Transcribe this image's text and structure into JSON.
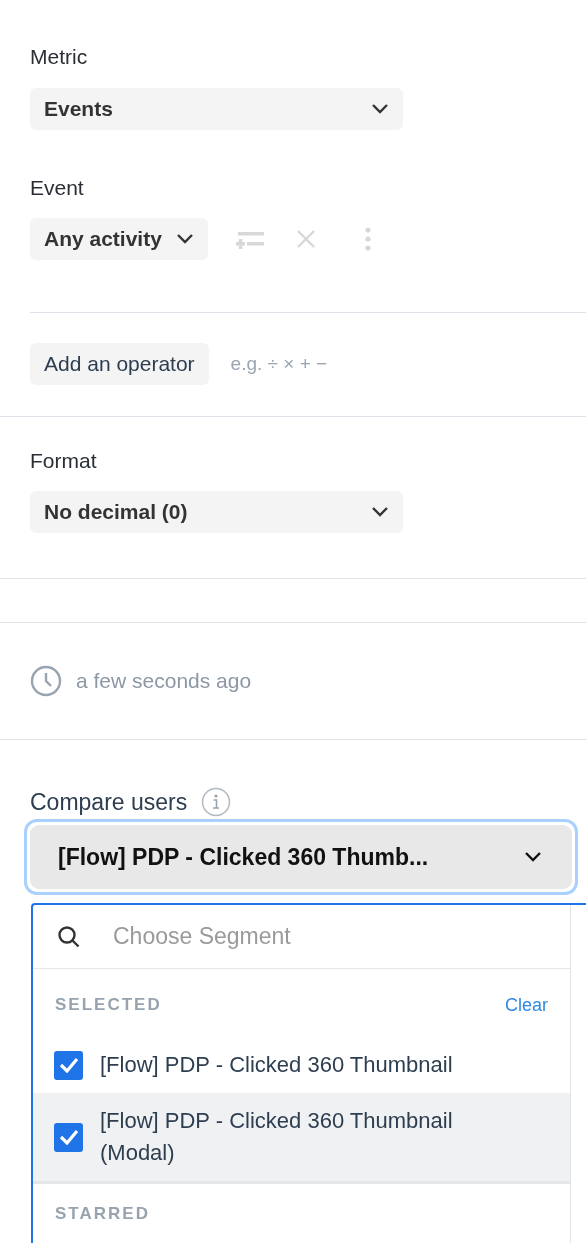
{
  "metric": {
    "label": "Metric",
    "value": "Events"
  },
  "event": {
    "label": "Event",
    "value": "Any activity"
  },
  "operator": {
    "button": "Add an operator",
    "hint": "e.g. ÷ × + −"
  },
  "format": {
    "label": "Format",
    "value": "No decimal (0)"
  },
  "updated": "a few seconds ago",
  "compare": {
    "label": "Compare users",
    "value": "[Flow] PDP - Clicked 360 Thumb...",
    "focused": true
  },
  "segment_menu": {
    "search_placeholder": "Choose Segment",
    "sections": [
      {
        "heading": "SELECTED",
        "action": "Clear",
        "items": [
          {
            "label": "[Flow] PDP - Clicked 360 Thumbnail",
            "checked": true,
            "highlighted": false
          },
          {
            "label": "[Flow] PDP - Clicked 360 Thumbnail (Modal)",
            "checked": true,
            "highlighted": true
          }
        ]
      },
      {
        "heading": "STARRED"
      }
    ]
  }
}
